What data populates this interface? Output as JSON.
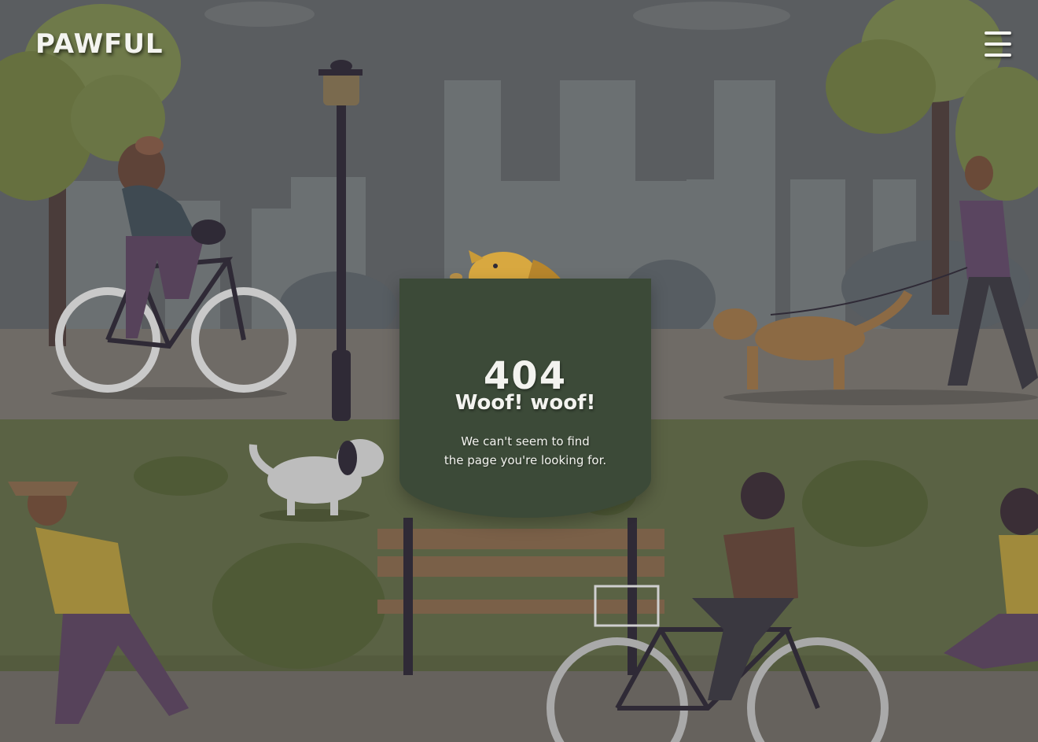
{
  "brand": {
    "name": "PAWFUL"
  },
  "nav": {
    "menu_icon": "hamburger-menu-icon"
  },
  "error": {
    "code": "404",
    "headline": "Woof! woof!",
    "message_line1": "We can't seem to find",
    "message_line2": "the page you're looking for."
  },
  "colors": {
    "card": "#3c4a38",
    "text": "#f3f3ef",
    "dog": "#d8a840"
  }
}
